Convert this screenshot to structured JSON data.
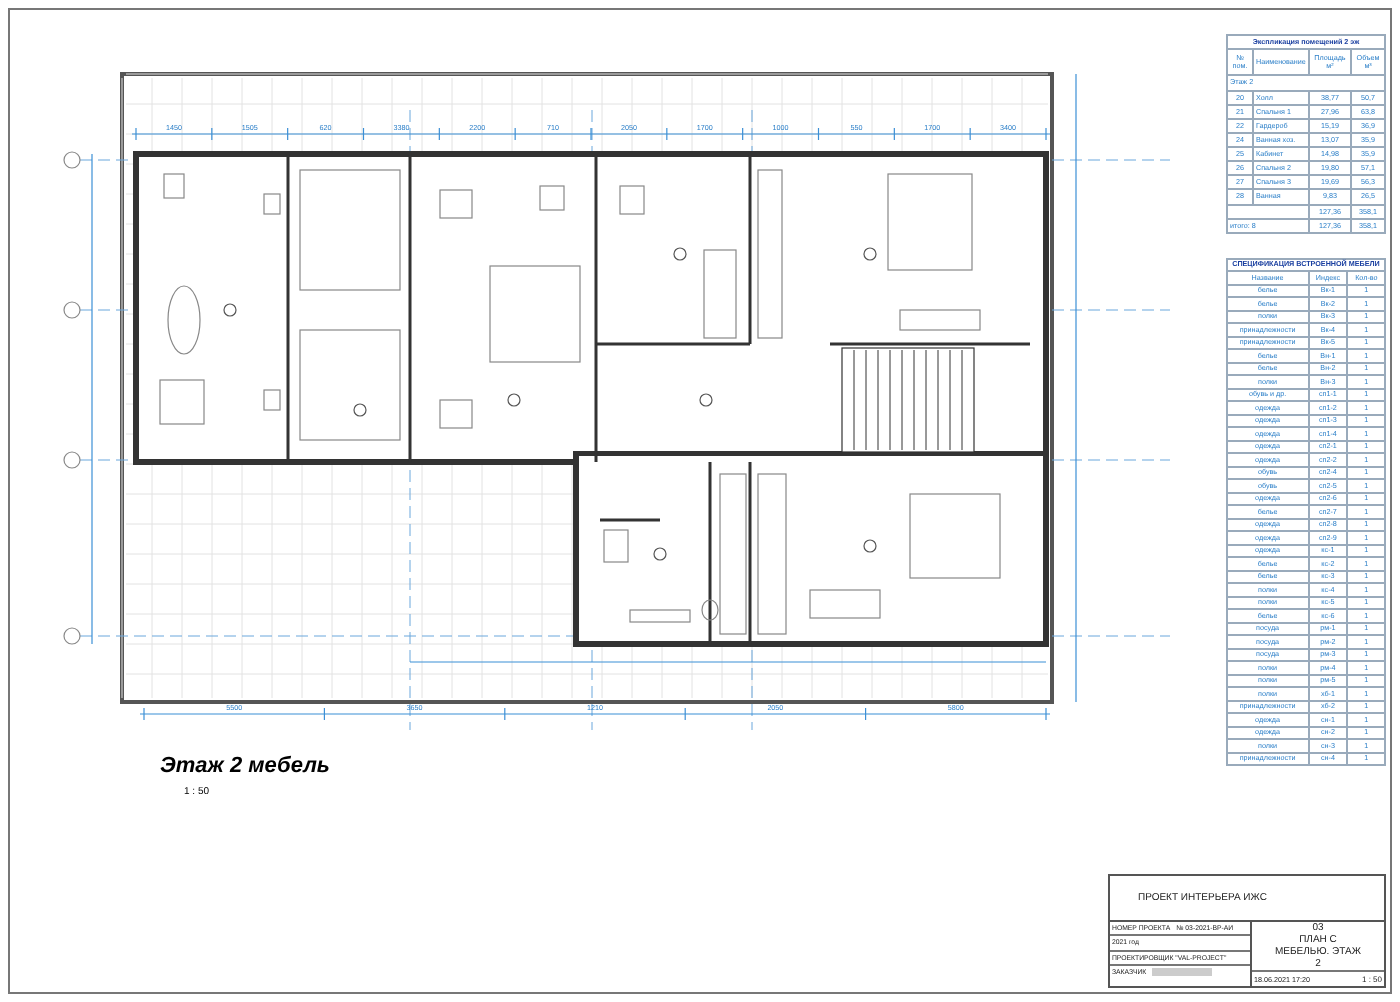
{
  "plan": {
    "top_dimensions": [
      "1450",
      "1505",
      "620",
      "3380",
      "2200",
      "710",
      "2050",
      "1700",
      "1000",
      "550",
      "1700",
      "3400"
    ],
    "bottom_dimensions": [
      "5500",
      "3650",
      "1210",
      "2050",
      "5800"
    ],
    "label": "Этаж 2 мебель",
    "scale": "1 : 50"
  },
  "explication": {
    "title": "Экспликация помещений 2 эж",
    "columns": [
      "№ пом.",
      "Наименование",
      "Площадь м²",
      "Объем м³"
    ],
    "section": "Этаж 2",
    "rows": [
      {
        "number": "20",
        "name": "Холл",
        "area": "38,77",
        "volume": "50,7"
      },
      {
        "number": "21",
        "name": "Спальня 1",
        "area": "27,96",
        "volume": "63,8"
      },
      {
        "number": "22",
        "name": "Гардероб",
        "area": "15,19",
        "volume": "36,9"
      },
      {
        "number": "24",
        "name": "Ванная хоз.",
        "area": "13,07",
        "volume": "35,9"
      },
      {
        "number": "25",
        "name": "Кабинет",
        "area": "14,98",
        "volume": "35,9"
      },
      {
        "number": "26",
        "name": "Спальня 2",
        "area": "19,80",
        "volume": "57,1"
      },
      {
        "number": "27",
        "name": "Спальня 3",
        "area": "19,69",
        "volume": "56,3"
      },
      {
        "number": "28",
        "name": "Ванная",
        "area": "9,83",
        "volume": "26,5"
      }
    ],
    "totals": [
      {
        "area": "127,36",
        "volume": "358,1"
      },
      {
        "label": "итого: 8",
        "area": "127,36",
        "volume": "358,1"
      }
    ]
  },
  "specification": {
    "title": "СПЕЦИФИКАЦИЯ ВСТРОЕННОЙ МЕБЕЛИ",
    "columns": [
      "Название",
      "Индекс",
      "Кол-во"
    ],
    "rows": [
      {
        "name": "белье",
        "index": "Вк-1",
        "count": "1"
      },
      {
        "name": "белье",
        "index": "Вк-2",
        "count": "1"
      },
      {
        "name": "полки",
        "index": "Вк-3",
        "count": "1"
      },
      {
        "name": "принадлежности",
        "index": "Вк-4",
        "count": "1"
      },
      {
        "name": "принадлежности",
        "index": "Вк-5",
        "count": "1"
      },
      {
        "name": "белье",
        "index": "Вн-1",
        "count": "1"
      },
      {
        "name": "белье",
        "index": "Вн-2",
        "count": "1"
      },
      {
        "name": "полки",
        "index": "Вн-3",
        "count": "1"
      },
      {
        "name": "обувь и др.",
        "index": "сп1-1",
        "count": "1"
      },
      {
        "name": "одежда",
        "index": "сп1-2",
        "count": "1"
      },
      {
        "name": "одежда",
        "index": "сп1-3",
        "count": "1"
      },
      {
        "name": "одежда",
        "index": "сп1-4",
        "count": "1"
      },
      {
        "name": "одежда",
        "index": "сп2-1",
        "count": "1"
      },
      {
        "name": "одежда",
        "index": "сп2-2",
        "count": "1"
      },
      {
        "name": "обувь",
        "index": "сп2-4",
        "count": "1"
      },
      {
        "name": "обувь",
        "index": "сп2-5",
        "count": "1"
      },
      {
        "name": "одежда",
        "index": "сп2-6",
        "count": "1"
      },
      {
        "name": "белье",
        "index": "сп2-7",
        "count": "1"
      },
      {
        "name": "одежда",
        "index": "сп2-8",
        "count": "1"
      },
      {
        "name": "одежда",
        "index": "сп2-9",
        "count": "1"
      },
      {
        "name": "одежда",
        "index": "кс-1",
        "count": "1"
      },
      {
        "name": "белье",
        "index": "кс-2",
        "count": "1"
      },
      {
        "name": "белье",
        "index": "кс-3",
        "count": "1"
      },
      {
        "name": "полки",
        "index": "кс-4",
        "count": "1"
      },
      {
        "name": "полки",
        "index": "кс-5",
        "count": "1"
      },
      {
        "name": "белье",
        "index": "кс-6",
        "count": "1"
      },
      {
        "name": "посуда",
        "index": "рм-1",
        "count": "1"
      },
      {
        "name": "посуда",
        "index": "рм-2",
        "count": "1"
      },
      {
        "name": "посуда",
        "index": "рм-3",
        "count": "1"
      },
      {
        "name": "полки",
        "index": "рм-4",
        "count": "1"
      },
      {
        "name": "полки",
        "index": "рм-5",
        "count": "1"
      },
      {
        "name": "полки",
        "index": "хб-1",
        "count": "1"
      },
      {
        "name": "принадлежности",
        "index": "хб-2",
        "count": "1"
      },
      {
        "name": "одежда",
        "index": "сн-1",
        "count": "1"
      },
      {
        "name": "одежда",
        "index": "сн-2",
        "count": "1"
      },
      {
        "name": "полки",
        "index": "сн-3",
        "count": "1"
      },
      {
        "name": "принадлежности",
        "index": "сн-4",
        "count": "1"
      }
    ]
  },
  "title_block": {
    "project": "ПРОЕКТ ИНТЕРЬЕРА ИЖС",
    "project_number_label": "НОМЕР ПРОЕКТА",
    "project_number": "№ 03-2021-ВР-АИ",
    "year": "2021 год",
    "designer": "ПРОЕКТИРОВЩИК \"VAL-PROJECT\"",
    "client_label": "ЗАКАЗЧИК",
    "sheet": "03",
    "sheet_title": "ПЛАН С МЕБЕЛЬЮ. ЭТАЖ 2",
    "date": "18.06.2021 17:20",
    "scale": "1 : 50"
  }
}
